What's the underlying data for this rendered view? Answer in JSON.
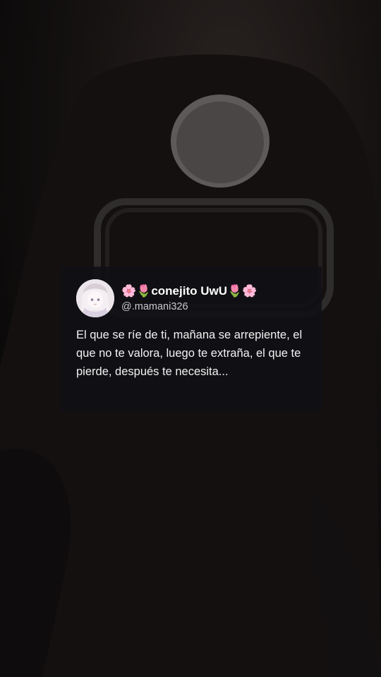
{
  "post": {
    "display_name": "🌸🌷conejito UwU🌷🌸",
    "handle": "@.mamani326",
    "text": "El que se ríe de ti, mañana se arrepiente, el que no te valora, luego te extraña, el que te pierde, después te necesita...",
    "avatar_icon": "anime-girl-avatar-icon"
  },
  "colors": {
    "card_background": "#101014",
    "text_primary": "#ffffff",
    "text_secondary": "#c9c9cc"
  }
}
